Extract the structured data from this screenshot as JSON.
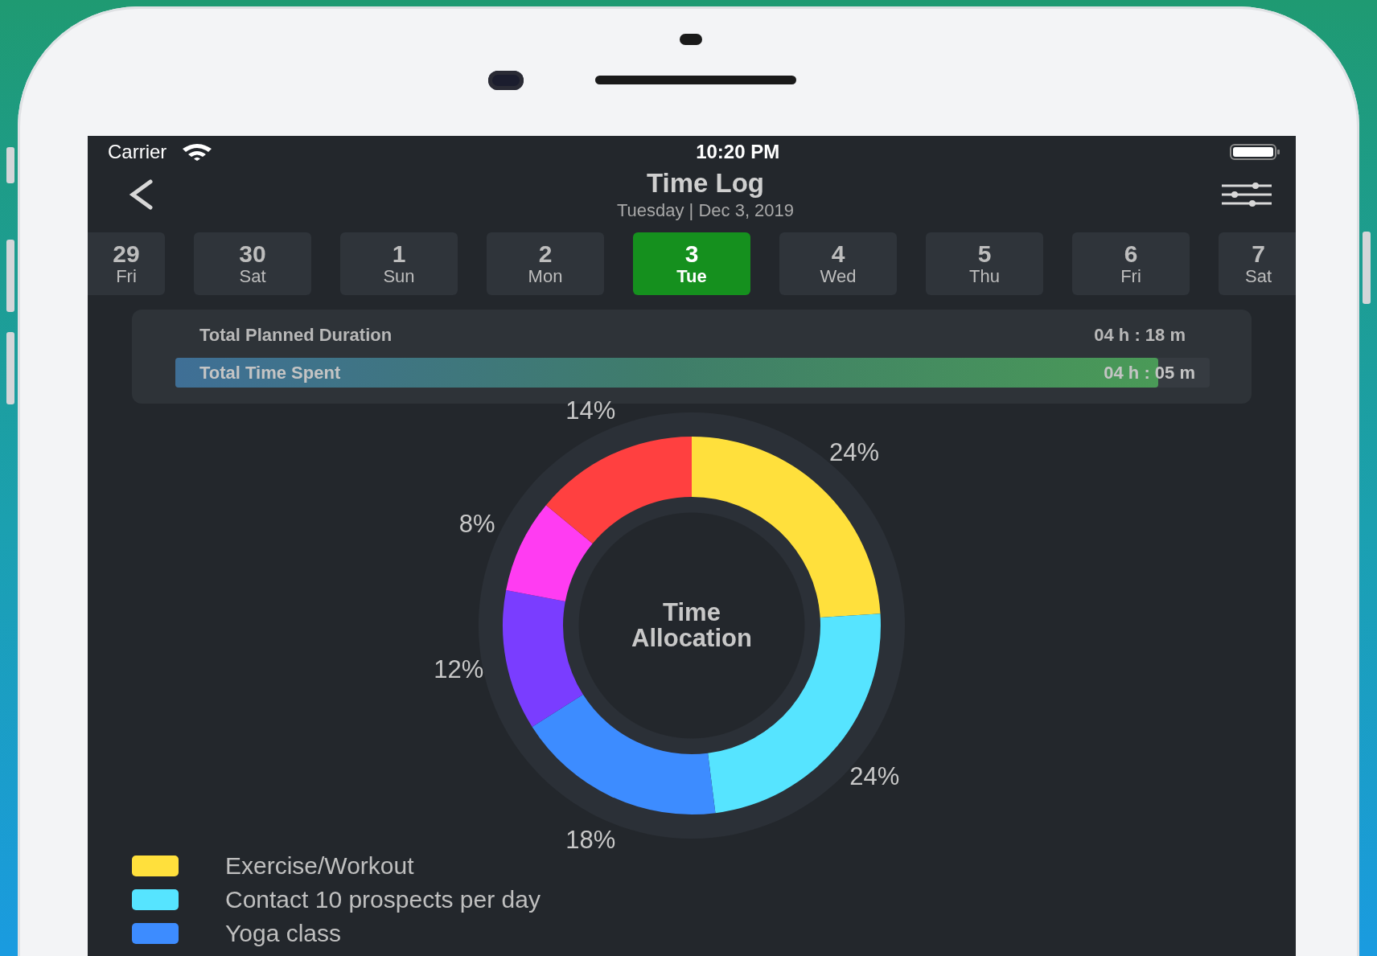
{
  "status_bar": {
    "carrier": "Carrier",
    "time": "10:20 PM"
  },
  "header": {
    "title": "Time Log",
    "subtitle": "Tuesday | Dec 3, 2019"
  },
  "dates": [
    {
      "day": "29",
      "weekday": "Fri",
      "selected": false
    },
    {
      "day": "30",
      "weekday": "Sat",
      "selected": false
    },
    {
      "day": "1",
      "weekday": "Sun",
      "selected": false
    },
    {
      "day": "2",
      "weekday": "Mon",
      "selected": false
    },
    {
      "day": "3",
      "weekday": "Tue",
      "selected": true
    },
    {
      "day": "4",
      "weekday": "Wed",
      "selected": false
    },
    {
      "day": "5",
      "weekday": "Thu",
      "selected": false
    },
    {
      "day": "6",
      "weekday": "Fri",
      "selected": false
    },
    {
      "day": "7",
      "weekday": "Sat",
      "selected": false
    }
  ],
  "summary": {
    "planned_label": "Total Planned Duration",
    "planned_value": "04 h : 18 m",
    "spent_label": "Total Time Spent",
    "spent_value": "04 h : 05 m",
    "level": 0.95
  },
  "chart": {
    "center_label": "Time Allocation",
    "chart_data": {
      "type": "donut",
      "values": [
        24,
        24,
        18,
        12,
        8,
        14
      ],
      "value_labels": [
        "24%",
        "24%",
        "18%",
        "12%",
        "8%",
        "14%"
      ],
      "colors": [
        "#ffe03c",
        "#56e4ff",
        "#3d8cff",
        "#7a3dff",
        "#ff3cf2",
        "#ff4040"
      ]
    }
  },
  "legend": [
    {
      "label": "Exercise/Workout",
      "color": "#ffe03c"
    },
    {
      "label": "Contact 10 prospects per day",
      "color": "#56e4ff"
    },
    {
      "label": "Yoga class",
      "color": "#3d8cff"
    }
  ]
}
